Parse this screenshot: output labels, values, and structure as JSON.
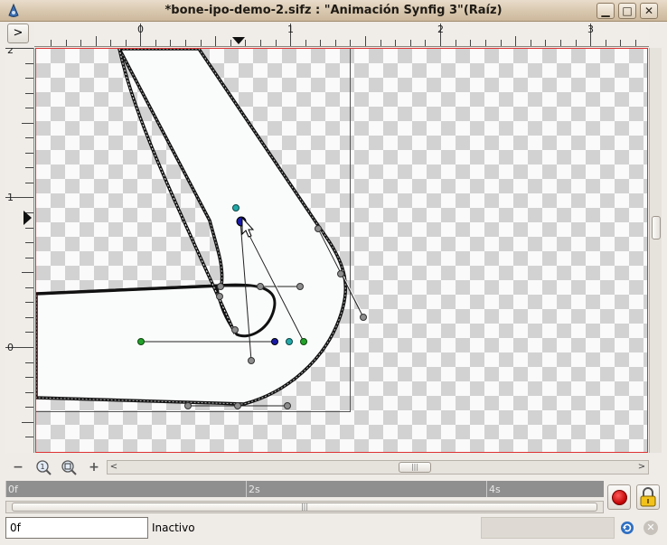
{
  "window": {
    "title": "*bone-ipo-demo-2.sifz : \"Animación Synfig 3\"(Raíz)",
    "minimize_glyph": "▁",
    "maximize_glyph": "□",
    "close_glyph": "✕"
  },
  "ruler_toggle_glyph": ">",
  "hruler": {
    "labels": [
      "0",
      "1",
      "2",
      "3"
    ]
  },
  "vruler": {
    "labels": [
      "2",
      "1",
      "0"
    ]
  },
  "canvas_toolbar": {
    "zoom_out_glyph": "−",
    "zoom_in_icon": "zoom-in-icon",
    "zoom_fit_icon": "zoom-fit-icon",
    "add_glyph": "+"
  },
  "scroll": {
    "left_glyph": "<",
    "right_glyph": ">",
    "grip": "|||"
  },
  "timebar": {
    "labels": [
      "0f",
      "2s",
      "4s"
    ]
  },
  "bottom": {
    "time_value": "0f",
    "status_text": "Inactivo"
  },
  "colors": {
    "title_bg": "#d8c7ae",
    "canvas_border": "#dd3333",
    "record": "#cc0000",
    "handle_green": "#22a22a",
    "handle_blue": "#1a1aa8",
    "handle_cyan": "#22a8a8"
  }
}
